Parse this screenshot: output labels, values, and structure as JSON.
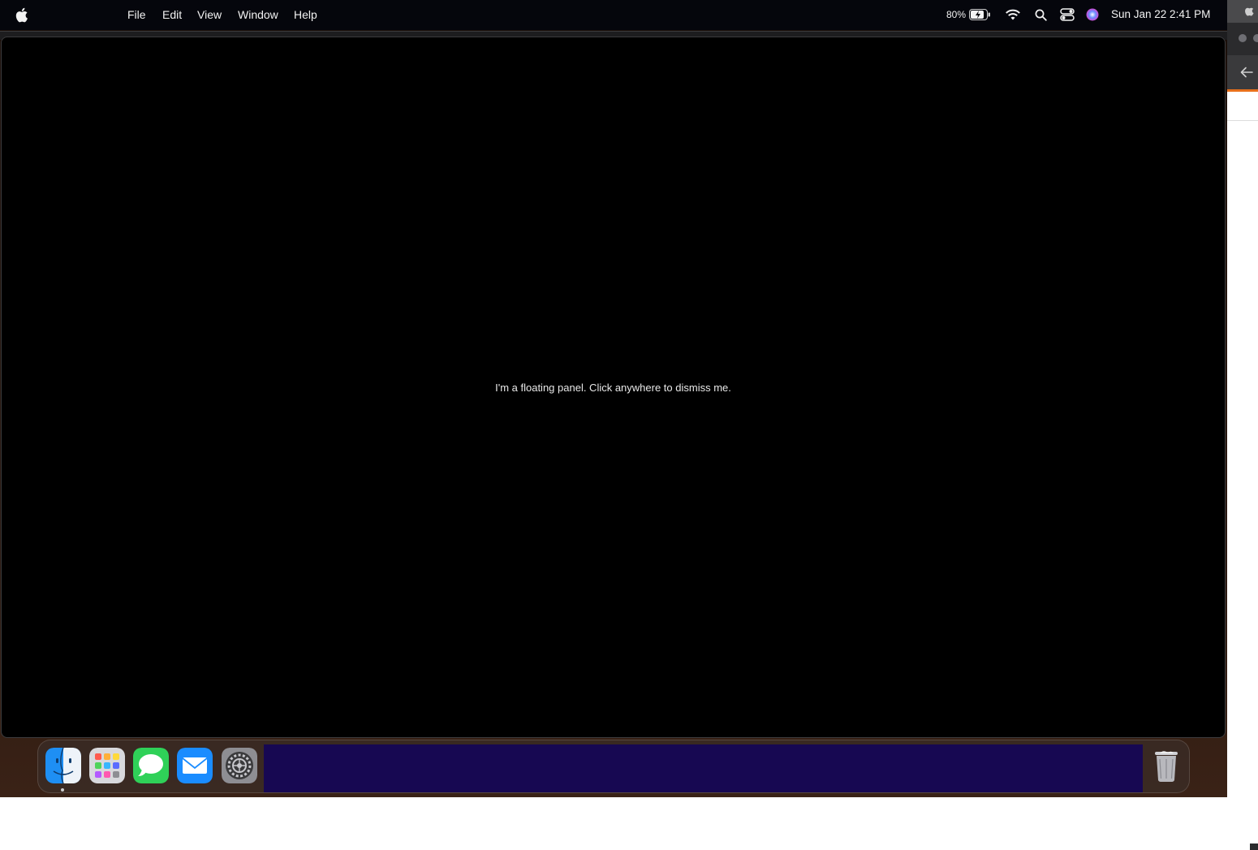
{
  "menubar": {
    "items": [
      "File",
      "Edit",
      "View",
      "Window",
      "Help"
    ],
    "battery_percent": "80%",
    "clock": "Sun Jan 22  2:41 PM"
  },
  "panel": {
    "message": "I'm a floating panel. Click anywhere to dismiss me."
  },
  "dock": {
    "apps": [
      "Finder",
      "Launchpad",
      "Messages",
      "Mail",
      "System Settings",
      "Trash"
    ]
  },
  "icons": {
    "apple": "apple-logo-icon",
    "battery": "battery-icon",
    "wifi": "wifi-icon",
    "spotlight": "search-icon",
    "control_center": "control-center-icon",
    "siri": "siri-icon",
    "back": "arrow-left-icon"
  },
  "colors": {
    "menubar_bg": "#05060c",
    "panel_bg": "#000000",
    "dock_placeholder": "#170852",
    "browser_accent": "#e8711c"
  }
}
